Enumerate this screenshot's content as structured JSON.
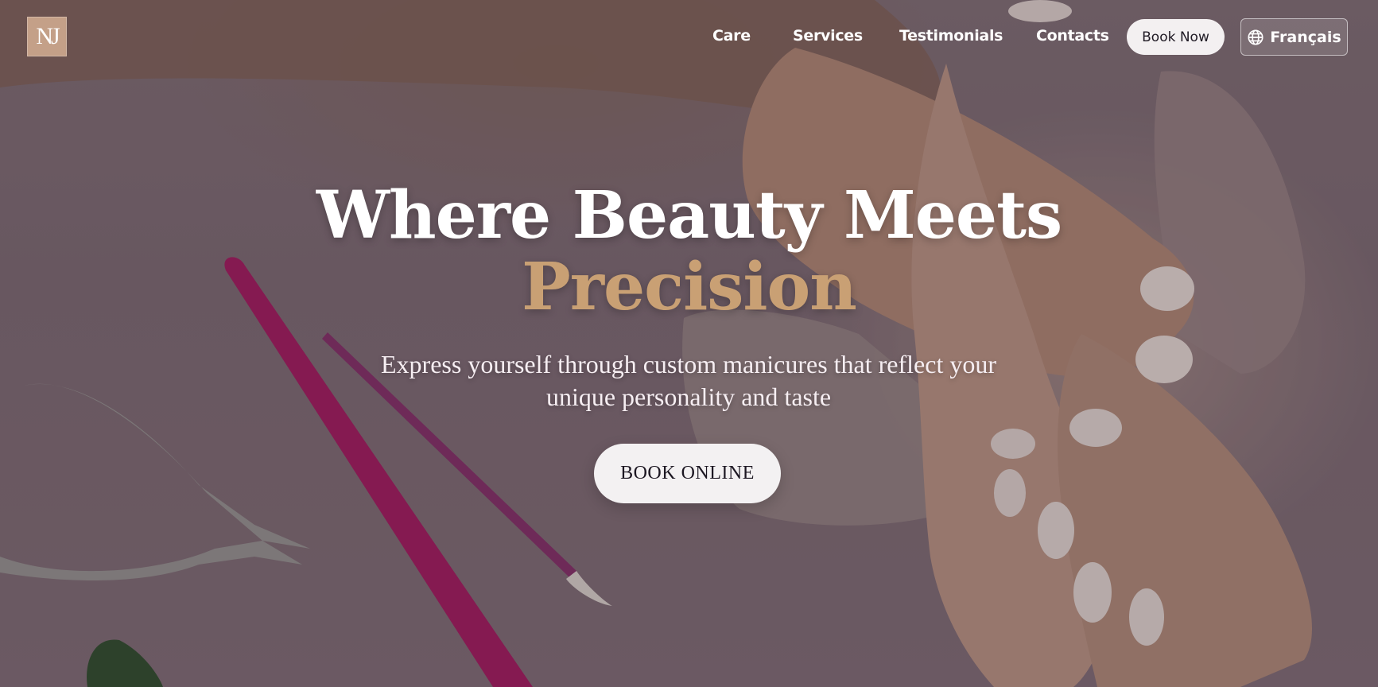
{
  "brand": {
    "logo_text": "NJ"
  },
  "nav": {
    "items": [
      "Care",
      "Services",
      "Testimonials",
      "Contacts"
    ],
    "book_now": "Book Now",
    "language": "Français"
  },
  "hero": {
    "headline": "Where Beauty Meets",
    "headline_accent": "Precision",
    "subtitle_line1": "Express yourself through custom manicures that reflect your",
    "subtitle_line2": "unique personality and taste",
    "cta": "BOOK ONLINE"
  },
  "colors": {
    "accent": "#c9a074",
    "logo_bg": "#c4a088",
    "button_bg": "#f3f1f2"
  }
}
